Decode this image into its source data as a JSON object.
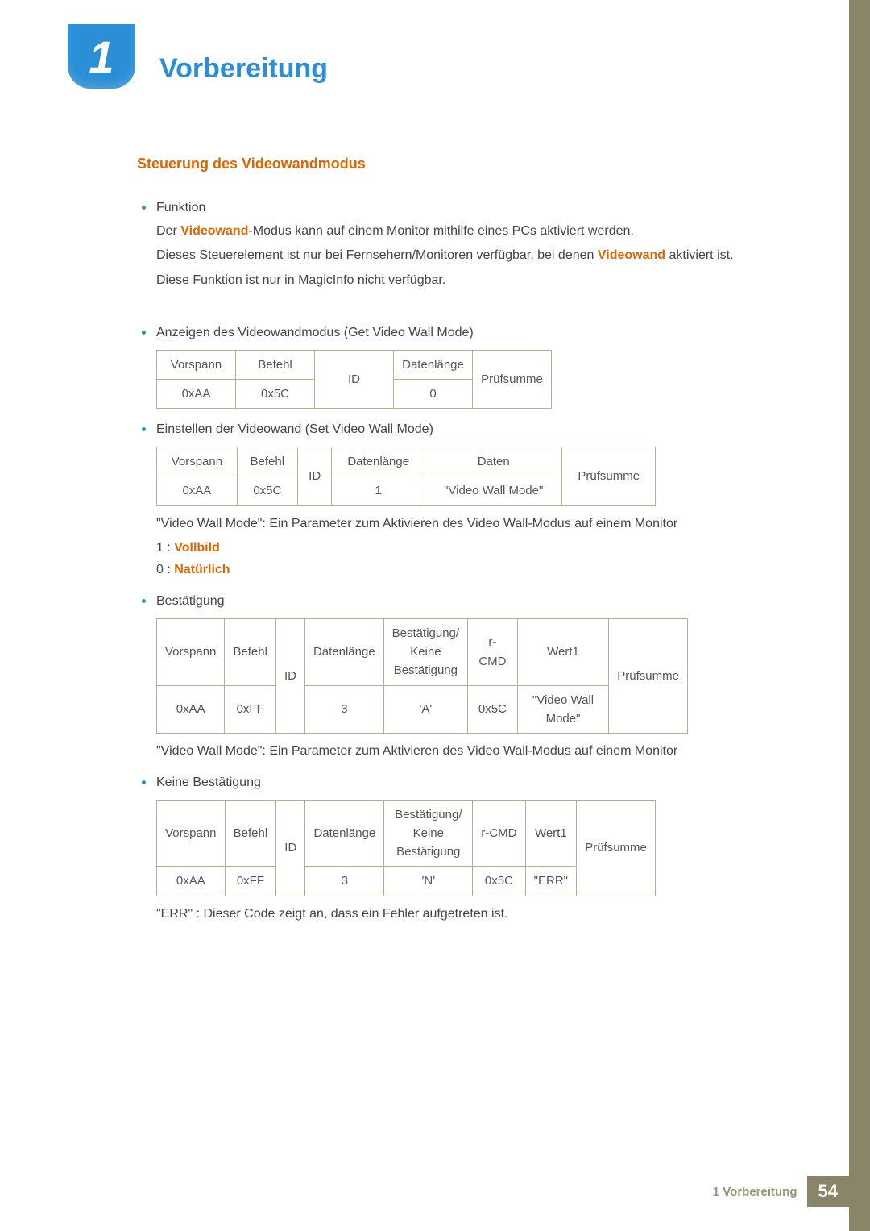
{
  "chapter": {
    "number": "1",
    "title": "Vorbereitung"
  },
  "section": {
    "title": "Steuerung des Videowandmodus"
  },
  "bullets": {
    "funktion": "Funktion",
    "anzeigen": "Anzeigen des Videowandmodus (Get Video Wall Mode)",
    "einstellen": "Einstellen der Videowand (Set Video Wall Mode)",
    "bestaetigung": "Bestätigung",
    "keine_bestaetigung": "Keine Bestätigung"
  },
  "paras": {
    "p1a": "Der ",
    "p1b": "Videowand",
    "p1c": "-Modus kann auf einem Monitor mithilfe eines PCs aktiviert werden.",
    "p2a": "Dieses Steuerelement ist nur bei Fernsehern/Monitoren verfügbar, bei denen ",
    "p2b": "Videowand",
    "p2c": " aktiviert ist.",
    "p3": "Diese Funktion ist nur in MagicInfo nicht verfügbar.",
    "p4": "\"Video Wall Mode\": Ein Parameter zum Aktivieren des Video Wall-Modus auf einem Monitor",
    "mode1_a": "1 : ",
    "mode1_b": "Vollbild",
    "mode0_a": "0 : ",
    "mode0_b": "Natürlich",
    "p5": "\"Video Wall Mode\": Ein Parameter zum Aktivieren des Video Wall-Modus auf einem Monitor",
    "p6": "\"ERR\" : Dieser Code zeigt an, dass ein Fehler aufgetreten ist."
  },
  "table1": {
    "h": [
      "Vorspann",
      "Befehl",
      "ID",
      "Datenlänge",
      "Prüfsumme"
    ],
    "r": [
      "0xAA",
      "0x5C",
      "0"
    ]
  },
  "table2": {
    "h": [
      "Vorspann",
      "Befehl",
      "ID",
      "Datenlänge",
      "Daten",
      "Prüfsumme"
    ],
    "r": [
      "0xAA",
      "0x5C",
      "1",
      "\"Video Wall Mode\""
    ]
  },
  "table3": {
    "h": [
      "Vorspann",
      "Befehl",
      "ID",
      "Datenlänge",
      "Bestätigung/ Keine Bestätigung",
      "r-CMD",
      "Wert1",
      "Prüfsumme"
    ],
    "r": [
      "0xAA",
      "0xFF",
      "3",
      "'A'",
      "0x5C",
      "\"Video Wall Mode\""
    ]
  },
  "table4": {
    "h": [
      "Vorspann",
      "Befehl",
      "ID",
      "Datenlänge",
      "Bestätigung/ Keine Bestätigung",
      "r-CMD",
      "Wert1",
      "Prüfsumme"
    ],
    "r": [
      "0xAA",
      "0xFF",
      "3",
      "'N'",
      "0x5C",
      "\"ERR\""
    ]
  },
  "footer": {
    "title": "1 Vorbereitung",
    "page": "54"
  }
}
